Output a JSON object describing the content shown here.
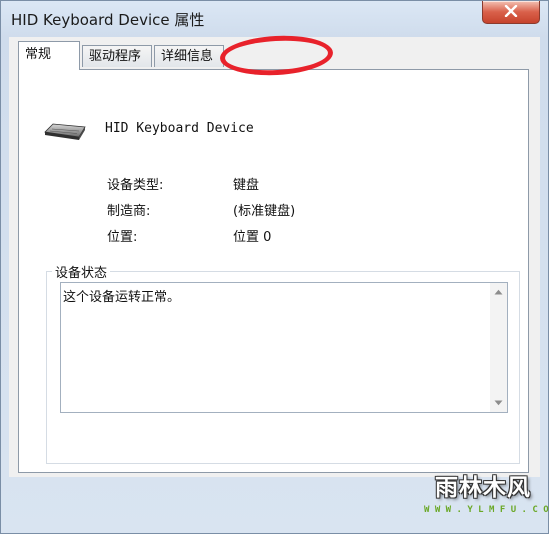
{
  "window": {
    "title": "HID Keyboard Device 属性"
  },
  "tabs": [
    {
      "label": "常规",
      "active": true
    },
    {
      "label": "驱动程序",
      "active": false
    },
    {
      "label": "详细信息",
      "active": false
    }
  ],
  "device": {
    "name": "HID Keyboard Device",
    "icon": "keyboard-icon"
  },
  "properties": [
    {
      "label": "设备类型:",
      "value": "键盘"
    },
    {
      "label": "制造商:",
      "value": "(标准键盘)"
    },
    {
      "label": "位置:",
      "value": "位置 0"
    }
  ],
  "status": {
    "group_title": "设备状态",
    "text": "这个设备运转正常。"
  },
  "annotation": {
    "shape": "hand-drawn ellipse",
    "color": "#e8222b"
  },
  "watermark": {
    "brand": "雨林木风",
    "url": "W W W . Y L M F U . C O M"
  },
  "colors": {
    "close_button": "#c6432d",
    "frame": "#cfdcec",
    "annotation": "#e8222b",
    "watermark_url": "#6aa827"
  }
}
